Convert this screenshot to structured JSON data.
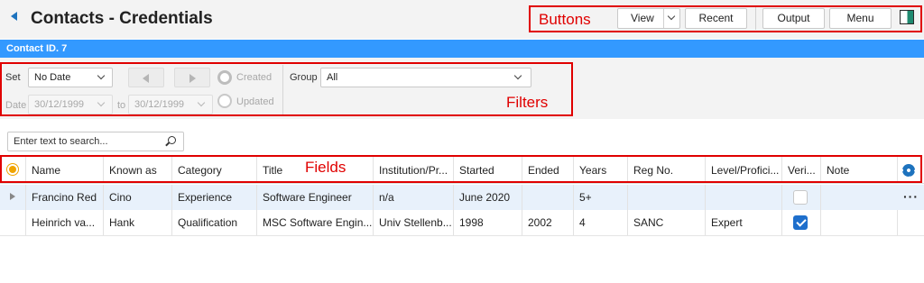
{
  "header": {
    "title": "Contacts - Credentials",
    "buttons": {
      "view": "View",
      "recent": "Recent",
      "output": "Output",
      "menu": "Menu"
    }
  },
  "annotations": {
    "buttons": "Buttons",
    "filters": "Filters",
    "fields": "Fields"
  },
  "contact_bar": "Contact ID. 7",
  "filters": {
    "set_label": "Set",
    "set_value": "No Date",
    "created_label": "Created",
    "updated_label": "Updated",
    "date_label": "Date",
    "date_from": "30/12/1999",
    "to_label": "to",
    "date_to": "30/12/1999",
    "group_label": "Group",
    "group_value": "All"
  },
  "search": {
    "placeholder": "Enter text to search..."
  },
  "table": {
    "columns": [
      "Name",
      "Known as",
      "Category",
      "Title",
      "Institution/Pr...",
      "Started",
      "Ended",
      "Years",
      "Reg No.",
      "Level/Profici...",
      "Veri...",
      "Note"
    ],
    "rows": [
      {
        "name": "Francino Red",
        "known_as": "Cino",
        "category": "Experience",
        "title": "Software Engineer",
        "institution": "n/a",
        "started": "June 2020",
        "ended": "",
        "years": "5+",
        "reg_no": "",
        "level": "",
        "verified": false,
        "note": ""
      },
      {
        "name": "Heinrich va...",
        "known_as": "Hank",
        "category": "Qualification",
        "title": "MSC Software Engin...",
        "institution": "Univ Stellenb...",
        "started": "1998",
        "ended": "2002",
        "years": "4",
        "reg_no": "SANC",
        "level": "Expert",
        "verified": true,
        "note": ""
      }
    ],
    "row_menu": "···"
  },
  "colors": {
    "accent": "#3399ff",
    "annotation": "#e00000",
    "checked": "#1e6fcc"
  },
  "icons": [
    "back-arrow-icon",
    "chevron-down-icon",
    "panel-toggle-icon",
    "search-icon",
    "sun-icon",
    "gear-icon",
    "expand-row-icon",
    "checkbox-icon",
    "more-icon"
  ]
}
